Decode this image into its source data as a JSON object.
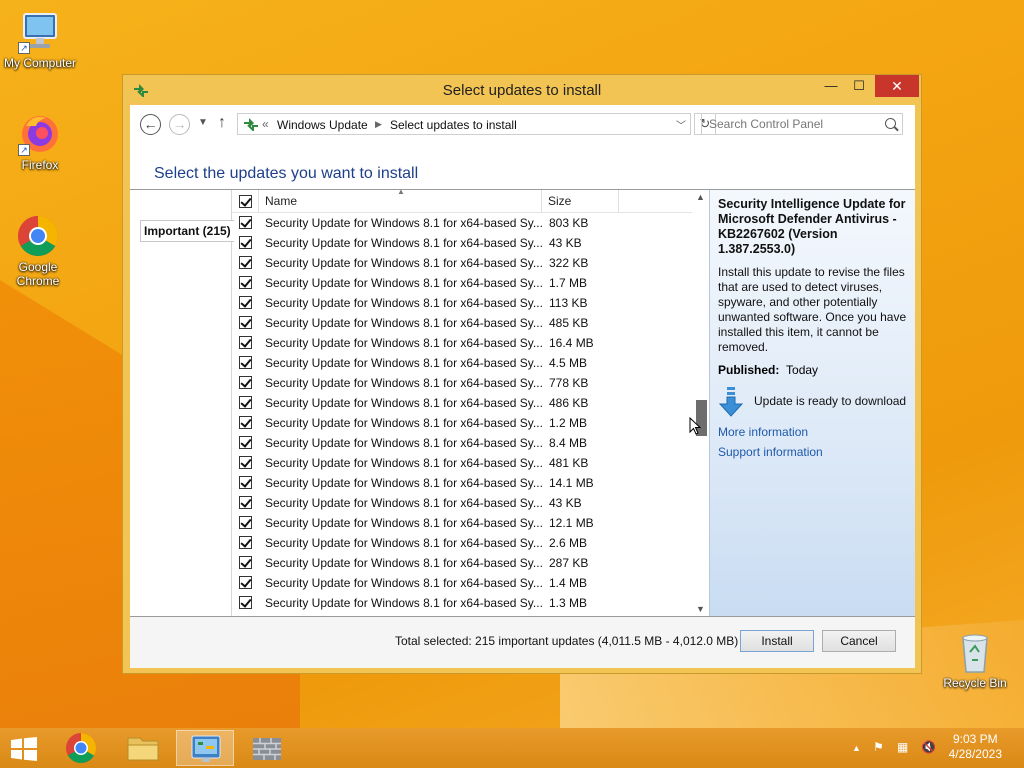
{
  "desktop": {
    "icons": [
      {
        "label": "My Computer"
      },
      {
        "label": "Firefox"
      },
      {
        "label": "Google Chrome"
      },
      {
        "label": "Recycle Bin"
      }
    ]
  },
  "window": {
    "title": "Select updates to install",
    "nav": {
      "crumb_sep": "«",
      "crumbs": [
        "Windows Update",
        "Select updates to install"
      ],
      "search_placeholder": "Search Control Panel"
    },
    "heading": "Select the updates you want to install",
    "category_tab": "Important (215)",
    "columns": {
      "name": "Name",
      "size": "Size"
    },
    "updates": [
      {
        "name": "Security Update for Windows 8.1 for x64-based Sy...",
        "size": "803 KB"
      },
      {
        "name": "Security Update for Windows 8.1 for x64-based Sy...",
        "size": "43 KB"
      },
      {
        "name": "Security Update for Windows 8.1 for x64-based Sy...",
        "size": "322 KB"
      },
      {
        "name": "Security Update for Windows 8.1 for x64-based Sy...",
        "size": "1.7 MB"
      },
      {
        "name": "Security Update for Windows 8.1 for x64-based Sy...",
        "size": "113 KB"
      },
      {
        "name": "Security Update for Windows 8.1 for x64-based Sy...",
        "size": "485 KB"
      },
      {
        "name": "Security Update for Windows 8.1 for x64-based Sy...",
        "size": "16.4 MB"
      },
      {
        "name": "Security Update for Windows 8.1 for x64-based Sy...",
        "size": "4.5 MB"
      },
      {
        "name": "Security Update for Windows 8.1 for x64-based Sy...",
        "size": "778 KB"
      },
      {
        "name": "Security Update for Windows 8.1 for x64-based Sy...",
        "size": "486 KB"
      },
      {
        "name": "Security Update for Windows 8.1 for x64-based Sy...",
        "size": "1.2 MB"
      },
      {
        "name": "Security Update for Windows 8.1 for x64-based Sy...",
        "size": "8.4 MB"
      },
      {
        "name": "Security Update for Windows 8.1 for x64-based Sy...",
        "size": "481 KB"
      },
      {
        "name": "Security Update for Windows 8.1 for x64-based Sy...",
        "size": "14.1 MB"
      },
      {
        "name": "Security Update for Windows 8.1 for x64-based Sy...",
        "size": "43 KB"
      },
      {
        "name": "Security Update for Windows 8.1 for x64-based Sy...",
        "size": "12.1 MB"
      },
      {
        "name": "Security Update for Windows 8.1 for x64-based Sy...",
        "size": "2.6 MB"
      },
      {
        "name": "Security Update for Windows 8.1 for x64-based Sy...",
        "size": "287 KB"
      },
      {
        "name": "Security Update for Windows 8.1 for x64-based Sy...",
        "size": "1.4 MB"
      },
      {
        "name": "Security Update for Windows 8.1 for x64-based Sy...",
        "size": "1.3 MB"
      }
    ],
    "detail": {
      "title": "Security Intelligence Update for Microsoft Defender Antivirus - KB2267602 (Version 1.387.2553.0)",
      "description": "Install this update to revise the files that are used to detect viruses, spyware, and other potentially unwanted software. Once you have installed this item, it cannot be removed.",
      "published_label": "Published:",
      "published_value": "Today",
      "status": "Update is ready to download",
      "more_info": "More information",
      "support_info": "Support information"
    },
    "footer": {
      "total": "Total selected: 215 important updates (4,011.5 MB - 4,012.0 MB)",
      "install": "Install",
      "cancel": "Cancel"
    }
  },
  "taskbar": {
    "time": "9:03 PM",
    "date": "4/28/2023"
  },
  "colors": {
    "accent": "#1e3f8a",
    "link": "#1e5aaa",
    "close": "#c7352b"
  }
}
